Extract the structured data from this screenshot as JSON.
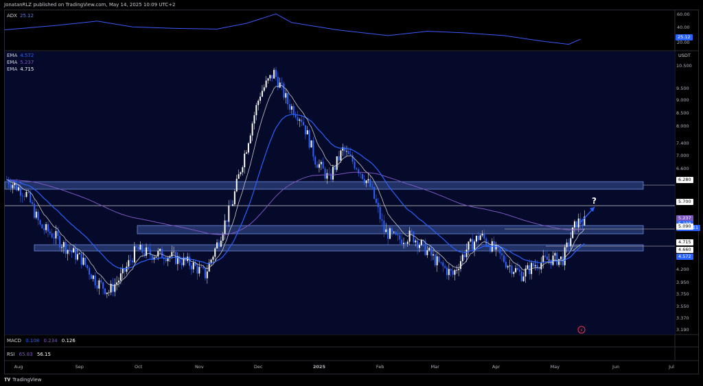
{
  "header": {
    "publish_line": "JonatanRLZ published on TradingView.com, May 14, 2025 10:09 UTC+2"
  },
  "footer": {
    "brand": "TradingView"
  },
  "panes": {
    "adx": {
      "name": "ADX",
      "value": "25.12",
      "ticks": [
        "60.00",
        "40.00",
        "20.00"
      ],
      "tag": "25.12"
    },
    "main": {
      "currency": "USDT",
      "ema_labels": [
        {
          "name": "EMA",
          "value": "4.572",
          "color": "#2962ff"
        },
        {
          "name": "EMA",
          "value": "5.237",
          "color": "#7e57c2"
        },
        {
          "name": "EMA",
          "value": "4.715",
          "color": "#ffffff"
        }
      ],
      "ticks": [
        "10.500",
        "9.500",
        "9.000",
        "8.500",
        "8.000",
        "7.400",
        "7.000",
        "6.600",
        "6.280",
        "5.700",
        "5.237",
        "5.198",
        "15:50:11",
        "5.090",
        "4.715",
        "4.660",
        "4.572",
        "4.200",
        "3.950",
        "3.750",
        "3.550",
        "3.370",
        "3.190"
      ],
      "question": "?"
    },
    "macd": {
      "name": "MACD",
      "values": [
        "0.108",
        "0.234",
        "0.126"
      ]
    },
    "rsi": {
      "name": "RSI",
      "values": [
        "65.83",
        "56.15"
      ]
    }
  },
  "x_axis": [
    "Aug",
    "Sep",
    "Oct",
    "Nov",
    "Dec",
    "2025",
    "Feb",
    "Mar",
    "Apr",
    "May",
    "Jun",
    "Jul"
  ],
  "chart_data": {
    "type": "candlestick",
    "title": "",
    "currency": "USDT",
    "y_scale": "log",
    "ylim": [
      3.15,
      11.2
    ],
    "x_range": [
      "2024-07-25",
      "2025-07-01"
    ],
    "price_levels": [
      6.28,
      5.7,
      5.09,
      4.66
    ],
    "zones": [
      [
        6.12,
        6.45
      ],
      [
        4.98,
        5.25
      ],
      [
        4.6,
        4.78
      ]
    ],
    "last_price": 5.198,
    "countdown": "15:50:11",
    "ema_values": {
      "ema_blue": 4.572,
      "ema_purple": 5.237,
      "ema_white": 4.715
    },
    "candles_close_approx": [
      [
        "2024-07-26",
        6.3
      ],
      [
        "2024-08-05",
        5.9
      ],
      [
        "2024-08-12",
        5.1
      ],
      [
        "2024-08-19",
        4.9
      ],
      [
        "2024-08-26",
        4.6
      ],
      [
        "2024-09-02",
        4.4
      ],
      [
        "2024-09-09",
        4.0
      ],
      [
        "2024-09-16",
        3.8
      ],
      [
        "2024-09-23",
        4.1
      ],
      [
        "2024-09-30",
        4.6
      ],
      [
        "2024-10-07",
        4.5
      ],
      [
        "2024-10-14",
        4.5
      ],
      [
        "2024-10-21",
        4.4
      ],
      [
        "2024-10-28",
        4.3
      ],
      [
        "2024-11-04",
        4.1
      ],
      [
        "2024-11-11",
        4.8
      ],
      [
        "2024-11-18",
        5.7
      ],
      [
        "2024-11-25",
        7.3
      ],
      [
        "2024-12-02",
        9.3
      ],
      [
        "2024-12-09",
        10.2
      ],
      [
        "2024-12-16",
        8.9
      ],
      [
        "2024-12-23",
        8.3
      ],
      [
        "2024-12-30",
        6.9
      ],
      [
        "2025-01-06",
        6.3
      ],
      [
        "2025-01-13",
        7.2
      ],
      [
        "2025-01-20",
        6.7
      ],
      [
        "2025-01-27",
        6.1
      ],
      [
        "2025-02-03",
        5.0
      ],
      [
        "2025-02-10",
        4.8
      ],
      [
        "2025-02-17",
        4.9
      ],
      [
        "2025-02-24",
        4.6
      ],
      [
        "2025-03-03",
        4.3
      ],
      [
        "2025-03-10",
        4.1
      ],
      [
        "2025-03-17",
        4.6
      ],
      [
        "2025-03-24",
        4.9
      ],
      [
        "2025-03-31",
        4.6
      ],
      [
        "2025-04-07",
        4.3
      ],
      [
        "2025-04-14",
        4.1
      ],
      [
        "2025-04-21",
        4.3
      ],
      [
        "2025-04-28",
        4.4
      ],
      [
        "2025-05-05",
        4.4
      ],
      [
        "2025-05-12",
        5.2
      ]
    ],
    "adx": {
      "value": 25.12,
      "ylim": [
        10,
        65
      ]
    },
    "macd": {
      "macd": 0.108,
      "signal": 0.234,
      "hist": 0.126
    },
    "rsi": {
      "rsi": 65.83,
      "ma": 56.15
    }
  }
}
